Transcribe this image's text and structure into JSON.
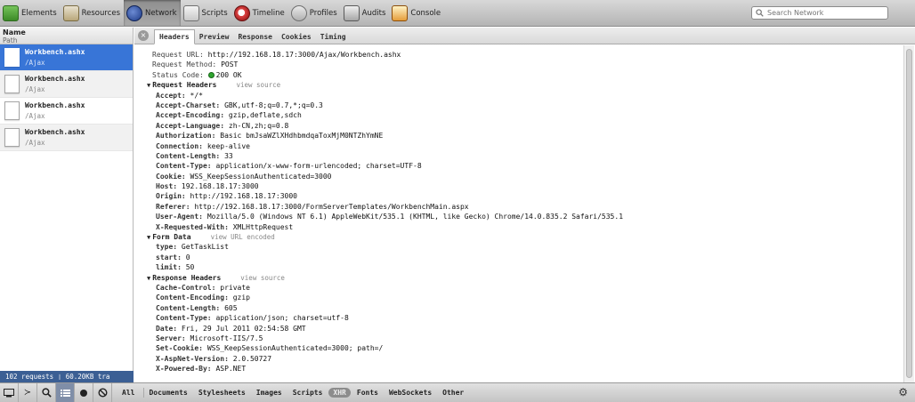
{
  "toolbar": {
    "tabs": [
      {
        "label": "Elements",
        "icon": "elements-icon"
      },
      {
        "label": "Resources",
        "icon": "resources-icon"
      },
      {
        "label": "Network",
        "icon": "network-icon"
      },
      {
        "label": "Scripts",
        "icon": "scripts-icon"
      },
      {
        "label": "Timeline",
        "icon": "timeline-icon"
      },
      {
        "label": "Profiles",
        "icon": "profiles-icon"
      },
      {
        "label": "Audits",
        "icon": "audits-icon"
      },
      {
        "label": "Console",
        "icon": "console-icon"
      }
    ],
    "active_tab": "Network",
    "search_placeholder": "Search Network"
  },
  "sidebar": {
    "header_name": "Name",
    "header_path": "Path",
    "requests": [
      {
        "name": "Workbench.ashx",
        "path": "/Ajax"
      },
      {
        "name": "Workbench.ashx",
        "path": "/Ajax"
      },
      {
        "name": "Workbench.ashx",
        "path": "/Ajax"
      },
      {
        "name": "Workbench.ashx",
        "path": "/Ajax"
      }
    ],
    "status": "102 requests  ❘  60.20KB tra"
  },
  "detail": {
    "close_glyph": "×",
    "tabs": [
      "Headers",
      "Preview",
      "Response",
      "Cookies",
      "Timing"
    ],
    "active_tab": "Headers",
    "general": [
      {
        "key": "Request URL:",
        "value": "http://192.168.18.17:3000/Ajax/Workbench.ashx"
      },
      {
        "key": "Request Method:",
        "value": "POST"
      },
      {
        "key": "Status Code:",
        "value": "200 OK"
      }
    ],
    "request_headers": {
      "title": "Request Headers",
      "link": "view source",
      "items": [
        {
          "key": "Accept:",
          "value": "*/*"
        },
        {
          "key": "Accept-Charset:",
          "value": "GBK,utf-8;q=0.7,*;q=0.3"
        },
        {
          "key": "Accept-Encoding:",
          "value": "gzip,deflate,sdch"
        },
        {
          "key": "Accept-Language:",
          "value": "zh-CN,zh;q=0.8"
        },
        {
          "key": "Authorization:",
          "value": "Basic bmJsaWZlXHdhbmdqaToxMjM0NTZhYmNE"
        },
        {
          "key": "Connection:",
          "value": "keep-alive"
        },
        {
          "key": "Content-Length:",
          "value": "33"
        },
        {
          "key": "Content-Type:",
          "value": "application/x-www-form-urlencoded; charset=UTF-8"
        },
        {
          "key": "Cookie:",
          "value": "WSS_KeepSessionAuthenticated=3000"
        },
        {
          "key": "Host:",
          "value": "192.168.18.17:3000"
        },
        {
          "key": "Origin:",
          "value": "http://192.168.18.17:3000"
        },
        {
          "key": "Referer:",
          "value": "http://192.168.18.17:3000/FormServerTemplates/WorkbenchMain.aspx"
        },
        {
          "key": "User-Agent:",
          "value": "Mozilla/5.0 (Windows NT 6.1) AppleWebKit/535.1 (KHTML, like Gecko) Chrome/14.0.835.2 Safari/535.1"
        },
        {
          "key": "X-Requested-With:",
          "value": "XMLHttpRequest"
        }
      ]
    },
    "form_data": {
      "title": "Form Data",
      "link": "view URL encoded",
      "items": [
        {
          "key": "type:",
          "value": "GetTaskList"
        },
        {
          "key": "start:",
          "value": "0"
        },
        {
          "key": "limit:",
          "value": "50"
        }
      ]
    },
    "response_headers": {
      "title": "Response Headers",
      "link": "view source",
      "items": [
        {
          "key": "Cache-Control:",
          "value": "private"
        },
        {
          "key": "Content-Encoding:",
          "value": "gzip"
        },
        {
          "key": "Content-Length:",
          "value": "605"
        },
        {
          "key": "Content-Type:",
          "value": "application/json; charset=utf-8"
        },
        {
          "key": "Date:",
          "value": "Fri, 29 Jul 2011 02:54:58 GMT"
        },
        {
          "key": "Server:",
          "value": "Microsoft-IIS/7.5"
        },
        {
          "key": "Set-Cookie:",
          "value": "WSS_KeepSessionAuthenticated=3000; path=/"
        },
        {
          "key": "X-AspNet-Version:",
          "value": "2.0.50727"
        },
        {
          "key": "X-Powered-By:",
          "value": "ASP.NET"
        }
      ]
    }
  },
  "bottom": {
    "filters": [
      "All",
      "Documents",
      "Stylesheets",
      "Images",
      "Scripts",
      "XHR",
      "Fonts",
      "WebSockets",
      "Other"
    ],
    "active_filter": "XHR"
  }
}
